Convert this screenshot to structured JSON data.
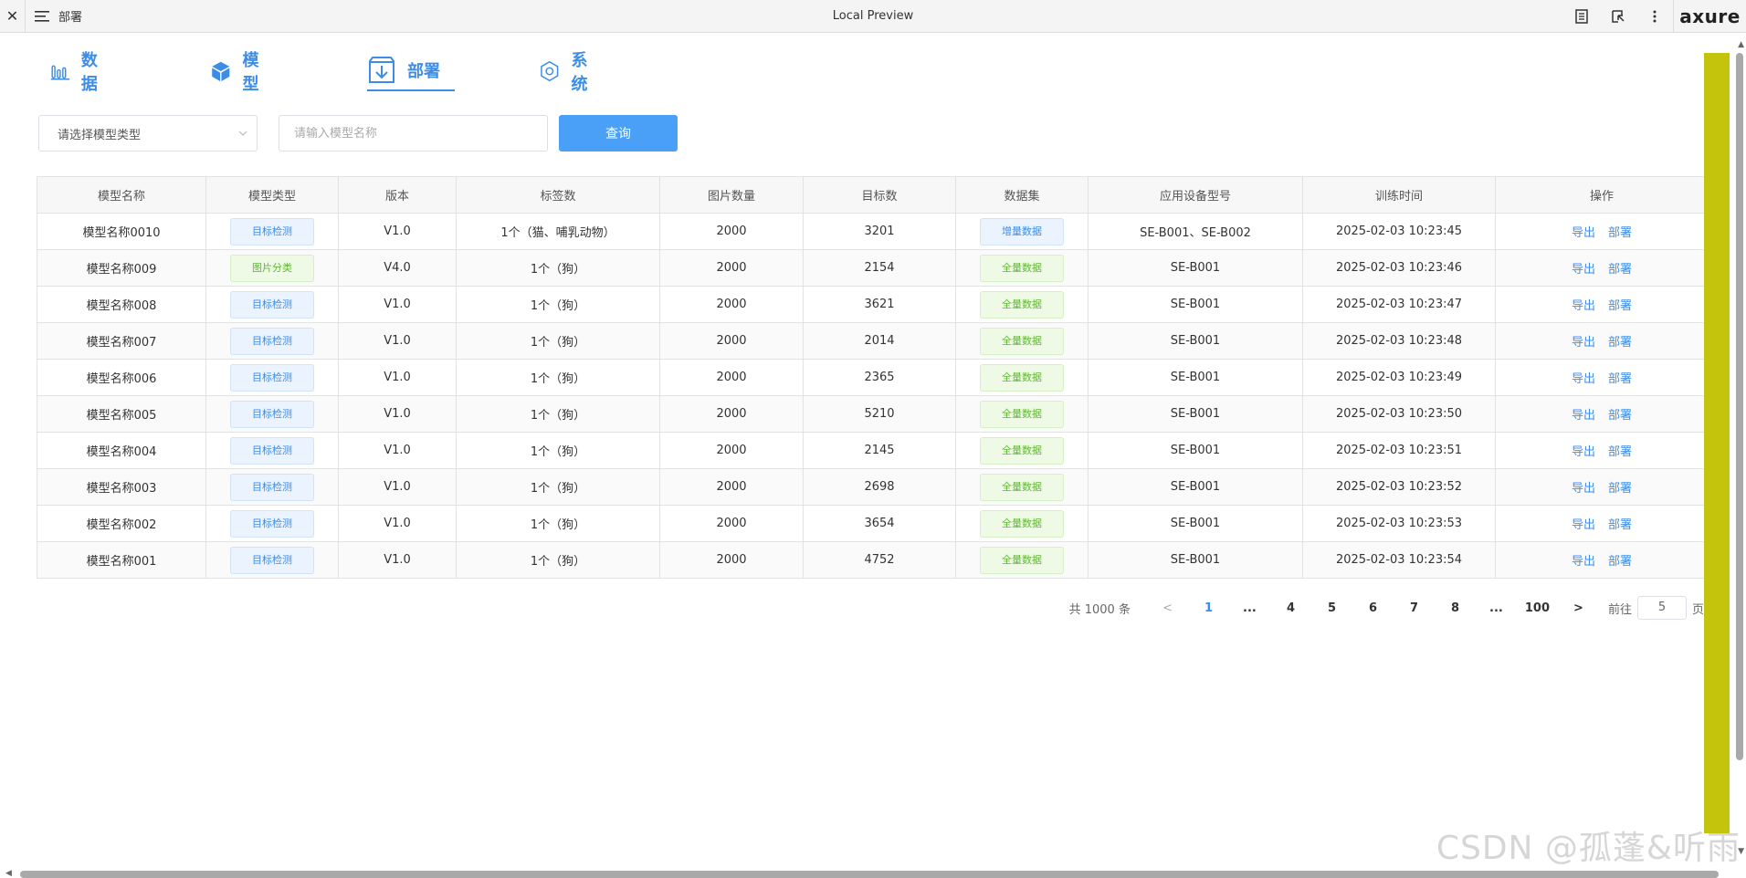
{
  "topbar": {
    "page_title": "部署",
    "window_title": "Local Preview",
    "logo_text": "axure"
  },
  "nav": {
    "items": [
      {
        "label": "数据",
        "icon": "bar-chart-icon"
      },
      {
        "label": "模型",
        "icon": "cube-icon"
      },
      {
        "label": "部署",
        "icon": "download-box-icon",
        "active": true
      },
      {
        "label": "系统",
        "icon": "hexagon-icon"
      }
    ]
  },
  "filters": {
    "type_select_value": "请选择模型类型",
    "name_placeholder": "请输入模型名称",
    "query_label": "查询"
  },
  "table": {
    "headers": [
      "模型名称",
      "模型类型",
      "版本",
      "标签数",
      "图片数量",
      "目标数",
      "数据集",
      "应用设备型号",
      "训练时间",
      "操作"
    ],
    "rows": [
      {
        "name": "模型名称0010",
        "type": "目标检测",
        "type_color": "blue",
        "version": "V1.0",
        "labels": "1个（猫、哺乳动物）",
        "images": "2000",
        "targets": "3201",
        "dataset": "增量数据",
        "dataset_color": "blue",
        "device": "SE-B001、SE-B002",
        "time": "2025-02-03 10:23:45"
      },
      {
        "name": "模型名称009",
        "type": "图片分类",
        "type_color": "green",
        "version": "V4.0",
        "labels": "1个（狗）",
        "images": "2000",
        "targets": "2154",
        "dataset": "全量数据",
        "dataset_color": "green",
        "device": "SE-B001",
        "time": "2025-02-03 10:23:46"
      },
      {
        "name": "模型名称008",
        "type": "目标检测",
        "type_color": "blue",
        "version": "V1.0",
        "labels": "1个（狗）",
        "images": "2000",
        "targets": "3621",
        "dataset": "全量数据",
        "dataset_color": "green",
        "device": "SE-B001",
        "time": "2025-02-03 10:23:47"
      },
      {
        "name": "模型名称007",
        "type": "目标检测",
        "type_color": "blue",
        "version": "V1.0",
        "labels": "1个（狗）",
        "images": "2000",
        "targets": "2014",
        "dataset": "全量数据",
        "dataset_color": "green",
        "device": "SE-B001",
        "time": "2025-02-03 10:23:48"
      },
      {
        "name": "模型名称006",
        "type": "目标检测",
        "type_color": "blue",
        "version": "V1.0",
        "labels": "1个（狗）",
        "images": "2000",
        "targets": "2365",
        "dataset": "全量数据",
        "dataset_color": "green",
        "device": "SE-B001",
        "time": "2025-02-03 10:23:49"
      },
      {
        "name": "模型名称005",
        "type": "目标检测",
        "type_color": "blue",
        "version": "V1.0",
        "labels": "1个（狗）",
        "images": "2000",
        "targets": "5210",
        "dataset": "全量数据",
        "dataset_color": "green",
        "device": "SE-B001",
        "time": "2025-02-03 10:23:50"
      },
      {
        "name": "模型名称004",
        "type": "目标检测",
        "type_color": "blue",
        "version": "V1.0",
        "labels": "1个（狗）",
        "images": "2000",
        "targets": "2145",
        "dataset": "全量数据",
        "dataset_color": "green",
        "device": "SE-B001",
        "time": "2025-02-03 10:23:51"
      },
      {
        "name": "模型名称003",
        "type": "目标检测",
        "type_color": "blue",
        "version": "V1.0",
        "labels": "1个（狗）",
        "images": "2000",
        "targets": "2698",
        "dataset": "全量数据",
        "dataset_color": "green",
        "device": "SE-B001",
        "time": "2025-02-03 10:23:52"
      },
      {
        "name": "模型名称002",
        "type": "目标检测",
        "type_color": "blue",
        "version": "V1.0",
        "labels": "1个（狗）",
        "images": "2000",
        "targets": "3654",
        "dataset": "全量数据",
        "dataset_color": "green",
        "device": "SE-B001",
        "time": "2025-02-03 10:23:53"
      },
      {
        "name": "模型名称001",
        "type": "目标检测",
        "type_color": "blue",
        "version": "V1.0",
        "labels": "1个（狗）",
        "images": "2000",
        "targets": "4752",
        "dataset": "全量数据",
        "dataset_color": "green",
        "device": "SE-B001",
        "time": "2025-02-03 10:23:54"
      }
    ],
    "op_export": "导出",
    "op_deploy": "部署"
  },
  "pagination": {
    "total": "共 1000 条",
    "prev": "<",
    "pages": [
      "1",
      "...",
      "4",
      "5",
      "6",
      "7",
      "8",
      "...",
      "100"
    ],
    "active_page": "1",
    "next": ">",
    "goto_label": "前往",
    "goto_value": "5",
    "goto_unit": "页"
  },
  "watermark": "CSDN @孤蓬&听雨",
  "colors": {
    "accent": "#3d8de6",
    "button": "#4aa0f7",
    "tag_green": "#62b635",
    "side_bar": "#c4c40d"
  }
}
